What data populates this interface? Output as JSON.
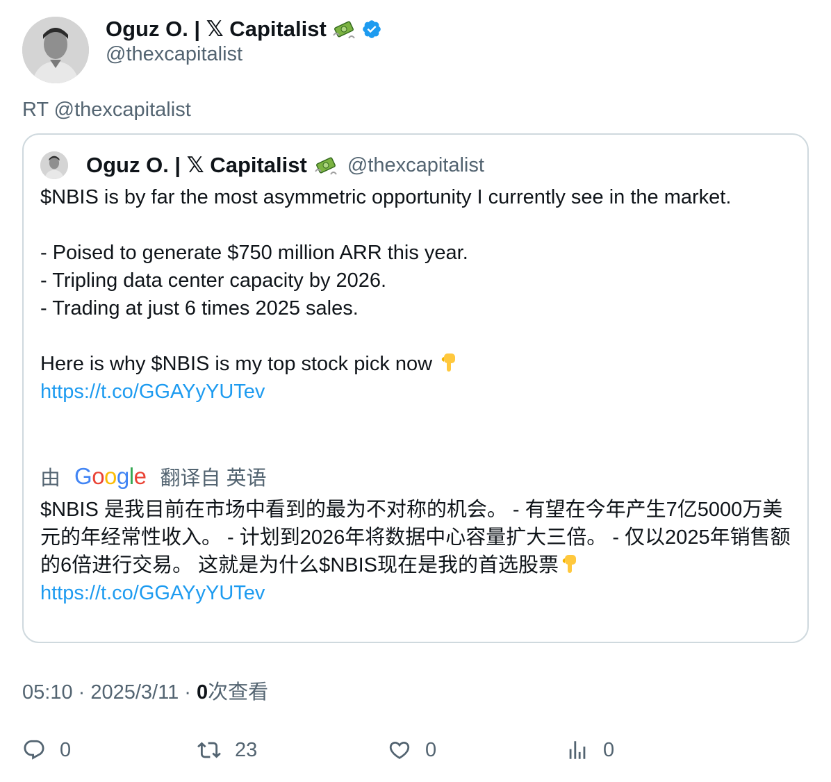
{
  "tweet": {
    "author_name": "Oguz O. | 𝕏 Capitalist",
    "author_handle": "@thexcapitalist",
    "retweet_text": "RT @thexcapitalist"
  },
  "quote": {
    "author_name": "Oguz O. | 𝕏 Capitalist",
    "author_handle": "@thexcapitalist",
    "line1": "$NBIS is by far the most asymmetric opportunity I currently see in the market.",
    "bullet1": "- Poised to generate $750 million ARR this year.",
    "bullet2": "- Tripling data center capacity by 2026.",
    "bullet3": "- Trading at just 6 times 2025 sales.",
    "closing": "Here is why $NBIS is my top stock pick now",
    "link": "https://t.co/GGAYyYUTev"
  },
  "translation": {
    "prefix": "由",
    "provider": "Google",
    "suffix": "翻译自 英语",
    "text": "$NBIS 是我目前在市场中看到的最为不对称的机会。 - 有望在今年产生7亿5000万美元的年经常性收入。 - 计划到2026年将数据中心容量扩大三倍。 - 仅以2025年销售额的6倍进行交易。 这就是为什么$NBIS现在是我的首选股票",
    "link": "https://t.co/GGAYyYUTev"
  },
  "meta": {
    "time": "05:10",
    "date": "2025/3/11",
    "views_count": "0",
    "views_label": "次查看"
  },
  "actions": {
    "replies": "0",
    "retweets": "23",
    "likes": "0",
    "views": "0"
  },
  "colors": {
    "link": "#1d9bf0",
    "secondary_text": "#536471",
    "verified": "#1d9bf0"
  }
}
